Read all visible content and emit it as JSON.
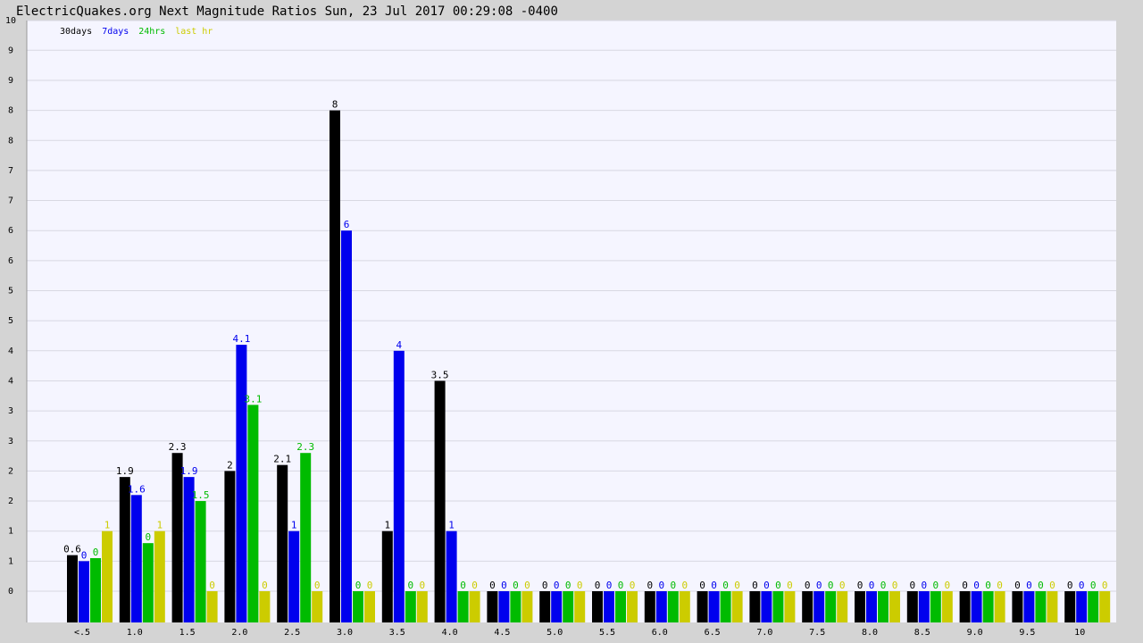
{
  "title": "ElectricQuakes.org Next Magnitude Ratios Sun, 23 Jul 2017 00:29:08 -0400",
  "chart_data": {
    "type": "bar",
    "title": "ElectricQuakes.org Next Magnitude Ratios Sun, 23 Jul 2017 00:29:08 -0400",
    "xlabel": "",
    "ylabel": "",
    "ylim": [
      -1,
      10
    ],
    "ytick_values": [
      0,
      1,
      2,
      3,
      4,
      5,
      6,
      7,
      8,
      9,
      10
    ],
    "ytick_labels": [
      "0",
      "1",
      "1",
      "2",
      "2",
      "3",
      "3",
      "4",
      "4",
      "5",
      "5",
      "6",
      "6",
      "7",
      "7",
      "8",
      "8",
      "9",
      "9",
      "10"
    ],
    "grid": true,
    "legend_position": "top-left",
    "categories": [
      "<.5",
      "1.0",
      "1.5",
      "2.0",
      "2.5",
      "3.0",
      "3.5",
      "4.0",
      "4.5",
      "5.0",
      "5.5",
      "6.0",
      "6.5",
      "7.0",
      "7.5",
      "8.0",
      "8.5",
      "9.0",
      "9.5",
      "10"
    ],
    "series": [
      {
        "name": "30days",
        "color": "#000000",
        "values": [
          0.6,
          1.9,
          2.3,
          2,
          2.1,
          8,
          1,
          3.5,
          0,
          0,
          0,
          0,
          0,
          0,
          0,
          0,
          0,
          0,
          0,
          0
        ],
        "labels": [
          "0.6",
          "1.9",
          "2.3",
          "2",
          "2.1",
          "8",
          "1",
          "3.5",
          "0",
          "0",
          "0",
          "0",
          "0",
          "0",
          "0",
          "0",
          "0",
          "0",
          "0",
          "0"
        ]
      },
      {
        "name": "7days",
        "color": "#0000ee",
        "values": [
          0.5,
          1.6,
          1.9,
          4.1,
          1,
          6,
          4,
          1,
          0,
          0,
          0,
          0,
          0,
          0,
          0,
          0,
          0,
          0,
          0,
          0
        ],
        "labels": [
          "0",
          "1.6",
          "1.9",
          "4.1",
          "1",
          "6",
          "4",
          "1",
          "0",
          "0",
          "0",
          "0",
          "0",
          "0",
          "0",
          "0",
          "0",
          "0",
          "0",
          "0"
        ]
      },
      {
        "name": "24hrs",
        "color": "#00bb00",
        "values": [
          0.55,
          0.8,
          1.5,
          3.1,
          2.3,
          0,
          0,
          0,
          0,
          0,
          0,
          0,
          0,
          0,
          0,
          0,
          0,
          0,
          0,
          0
        ],
        "labels": [
          "0",
          "0",
          "1.5",
          "3.1",
          "2.3",
          "0",
          "0",
          "0",
          "0",
          "0",
          "0",
          "0",
          "0",
          "0",
          "0",
          "0",
          "0",
          "0",
          "0",
          "0"
        ]
      },
      {
        "name": "last hr",
        "color": "#cccc00",
        "values": [
          1,
          1,
          0,
          0,
          0,
          0,
          0,
          0,
          0,
          0,
          0,
          0,
          0,
          0,
          0,
          0,
          0,
          0,
          0,
          0
        ],
        "labels": [
          "1",
          "1",
          "0",
          "0",
          "0",
          "0",
          "0",
          "0",
          "0",
          "0",
          "0",
          "0",
          "0",
          "0",
          "0",
          "0",
          "0",
          "0",
          "0",
          "0"
        ]
      }
    ]
  }
}
